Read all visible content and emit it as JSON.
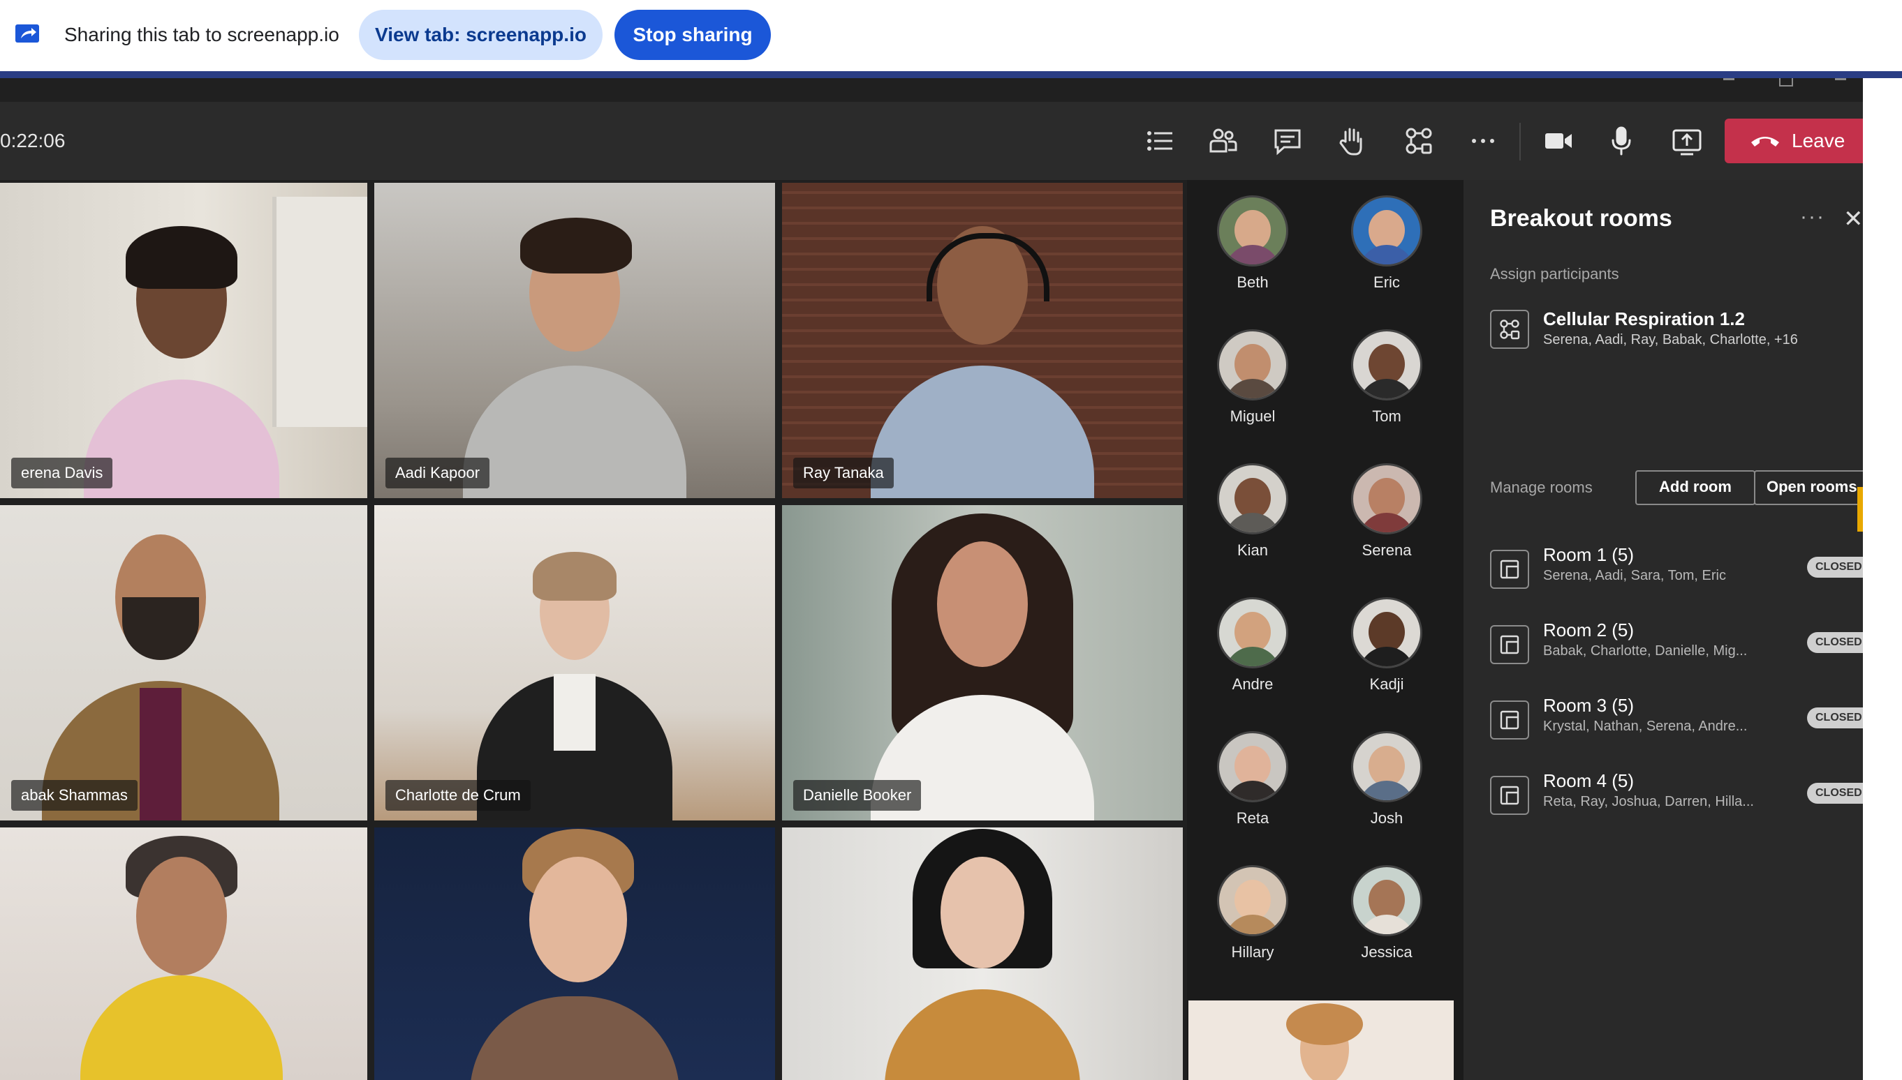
{
  "sharebar": {
    "text": "Sharing this tab to screenapp.io",
    "view_tab_label": "View tab: screenapp.io",
    "stop_label": "Stop sharing"
  },
  "toolbar": {
    "timer": "0:22:06",
    "leave_label": "Leave",
    "icons": [
      "list-icon",
      "people-icon",
      "chat-icon",
      "raise-hand-icon",
      "breakout-rooms-icon",
      "more-icon",
      "camera-icon",
      "microphone-icon",
      "share-screen-icon"
    ]
  },
  "videos": [
    {
      "name": "erena Davis"
    },
    {
      "name": "Aadi Kapoor"
    },
    {
      "name": "Ray Tanaka"
    },
    {
      "name": "abak Shammas"
    },
    {
      "name": "Charlotte de Crum"
    },
    {
      "name": "Danielle Booker"
    },
    {
      "name": ""
    },
    {
      "name": ""
    },
    {
      "name": ""
    }
  ],
  "gallery": [
    {
      "name": "Beth"
    },
    {
      "name": "Eric"
    },
    {
      "name": "Miguel"
    },
    {
      "name": "Tom"
    },
    {
      "name": "Kian"
    },
    {
      "name": "Serena"
    },
    {
      "name": "Andre"
    },
    {
      "name": "Kadji"
    },
    {
      "name": "Reta"
    },
    {
      "name": "Josh"
    },
    {
      "name": "Hillary"
    },
    {
      "name": "Jessica"
    }
  ],
  "panel": {
    "title": "Breakout rooms",
    "more": "···",
    "close": "✕",
    "assign_label": "Assign participants",
    "assign_title": "Cellular Respiration 1.2",
    "assign_sub": "Serena, Aadi, Ray, Babak, Charlotte, +16",
    "manage_label": "Manage rooms",
    "add_room": "Add room",
    "open_rooms": "Open rooms",
    "rooms": [
      {
        "title": "Room 1 (5)",
        "members": "Serena, Aadi, Sara, Tom, Eric",
        "status": "CLOSED"
      },
      {
        "title": "Room 2 (5)",
        "members": "Babak, Charlotte, Danielle, Mig...",
        "status": "CLOSED"
      },
      {
        "title": "Room 3 (5)",
        "members": "Krystal, Nathan, Serena, Andre...",
        "status": "CLOSED"
      },
      {
        "title": "Room 4 (5)",
        "members": "Reta, Ray, Joshua, Darren, Hilla...",
        "status": "CLOSED"
      }
    ]
  },
  "colors": {
    "leave": "#c4314b",
    "stop_sharing": "#1b57d8",
    "view_tab": "#d3e3fd",
    "accent": "#7b83eb"
  }
}
